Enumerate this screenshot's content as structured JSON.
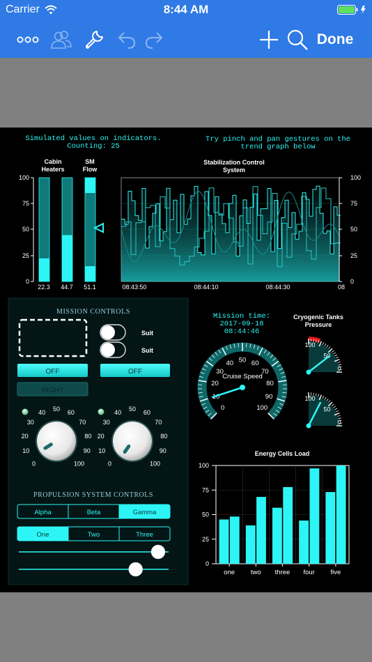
{
  "status": {
    "carrier": "Carrier",
    "time": "8:44 AM"
  },
  "navbar": {
    "done_label": "Done"
  },
  "dashboard": {
    "sim_text": [
      "Simulated values on indicators.",
      "Counting: 25"
    ],
    "try_text": [
      "Try pinch and pan gestures on the",
      "trend graph below"
    ],
    "bars": {
      "labels": [
        [
          "Cabin",
          "Heaters"
        ],
        [
          "SM",
          "Flow"
        ]
      ],
      "axis_ticks": [
        "100",
        "75",
        "50",
        "25",
        "0"
      ],
      "values": [
        22.3,
        44.7,
        51.1
      ],
      "value_labels": [
        "22.3",
        "44.7",
        "51.1"
      ]
    },
    "trend": {
      "title": [
        "Stabilization Control",
        "System"
      ],
      "x_labels": [
        "08:43:50",
        "08:44:10",
        "08:44:30",
        "08"
      ]
    },
    "mission": {
      "title": "MISSION CONTROLS",
      "suit1": "Suit",
      "suit2": "Suit",
      "off1": "OFF",
      "off2": "OFF",
      "right": "RIGHT",
      "knob_ticks": [
        "0",
        "10",
        "20",
        "30",
        "40",
        "50",
        "60",
        "70",
        "80",
        "90",
        "100"
      ]
    },
    "propulsion": {
      "title": "PROPULSION SYSTEM CONTROLS",
      "seg1": [
        "Alpha",
        "Beta",
        "Gamma"
      ],
      "seg1_selected": 2,
      "seg2": [
        "One",
        "Two",
        "Three"
      ],
      "seg2_selected": 0,
      "slider1": 0.93,
      "slider2": 0.78
    },
    "mission_time": {
      "label": "Mission time:",
      "date": "2017-09-18",
      "time": "08:44:46"
    },
    "speed": {
      "label": "Cruise Speed",
      "ticks": [
        "0",
        "10",
        "20",
        "30",
        "40",
        "50",
        "60",
        "70",
        "80",
        "90",
        "100"
      ],
      "value": 10
    },
    "tanks": {
      "title": [
        "Cryogenic Tanks",
        "Pressure"
      ],
      "g1": [
        "100",
        "50",
        "0"
      ],
      "g2": [
        "100",
        "50",
        "0"
      ],
      "v1": 42,
      "v2": 70
    },
    "energy": {
      "title": "Energy Cells Load",
      "y_ticks": [
        "100",
        "75",
        "50",
        "25",
        "0"
      ],
      "categories": [
        "one",
        "two",
        "three",
        "four",
        "five"
      ]
    }
  },
  "chart_data": {
    "type": "bar",
    "title": "Energy Cells Load",
    "categories": [
      "one",
      "two",
      "three",
      "four",
      "five"
    ],
    "series": [
      {
        "values": [
          45,
          39,
          57,
          44,
          73
        ]
      },
      {
        "values": [
          48,
          68,
          78,
          97,
          100
        ]
      }
    ],
    "ylim": [
      0,
      100
    ],
    "grid": true
  },
  "colors": {
    "accent": "#2f7ae5",
    "cyan": "#2ef5f5",
    "panel": "#041515"
  }
}
